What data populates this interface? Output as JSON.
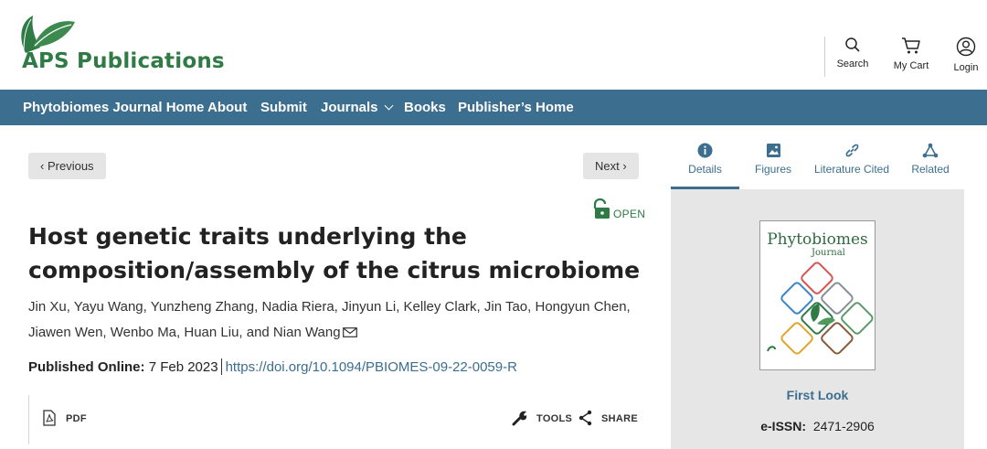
{
  "header": {
    "logo_text": "APS Publications",
    "utility": [
      {
        "label": "Search",
        "icon": "search-icon"
      },
      {
        "label": "My Cart",
        "icon": "cart-icon"
      },
      {
        "label": "Login",
        "icon": "user-icon"
      }
    ]
  },
  "nav": {
    "items": [
      "Phytobiomes Journal Home",
      "About",
      "Submit",
      "Journals",
      "Books",
      "Publisher’s Home"
    ]
  },
  "article": {
    "previous_label": "Previous",
    "next_label": "Next",
    "open_label": "OPEN",
    "title_lines": [
      "Host genetic traits underlying the",
      "composition/assembly of the citrus microbiome"
    ],
    "author_lines": [
      "Jin Xu, Yayu Wang, Yunzheng Zhang, Nadia Riera, Jinyun Li, Kelley Clark, Jin Tao, Hongyun Chen,",
      "Jiawen Wen, Wenbo Ma, Huan Liu, and Nian Wang"
    ],
    "published_label": "Published Online:",
    "published_date": "7 Feb 2023",
    "doi": "https://doi.org/10.1094/PBIOMES-09-22-0059-R"
  },
  "toolbar": {
    "pdf_label": "PDF",
    "tools_label": "TOOLS",
    "share_label": "SHARE"
  },
  "sidebar": {
    "tabs": [
      {
        "label": "Details",
        "icon": "info-icon",
        "active": true
      },
      {
        "label": "Figures",
        "icon": "image-icon"
      },
      {
        "label": "Literature Cited",
        "icon": "link-icon"
      },
      {
        "label": "Related",
        "icon": "share-nodes-icon"
      }
    ],
    "cover_title": "Phytobiomes",
    "cover_subtitle": "Journal",
    "first_look_label": "First Look",
    "issn_label": "e-ISSN:",
    "issn_value": "2471-2906"
  },
  "colors": {
    "brand_green": "#2f7a45",
    "nav_blue": "#3b6e8f",
    "panel_gray": "#e6e6e6"
  }
}
